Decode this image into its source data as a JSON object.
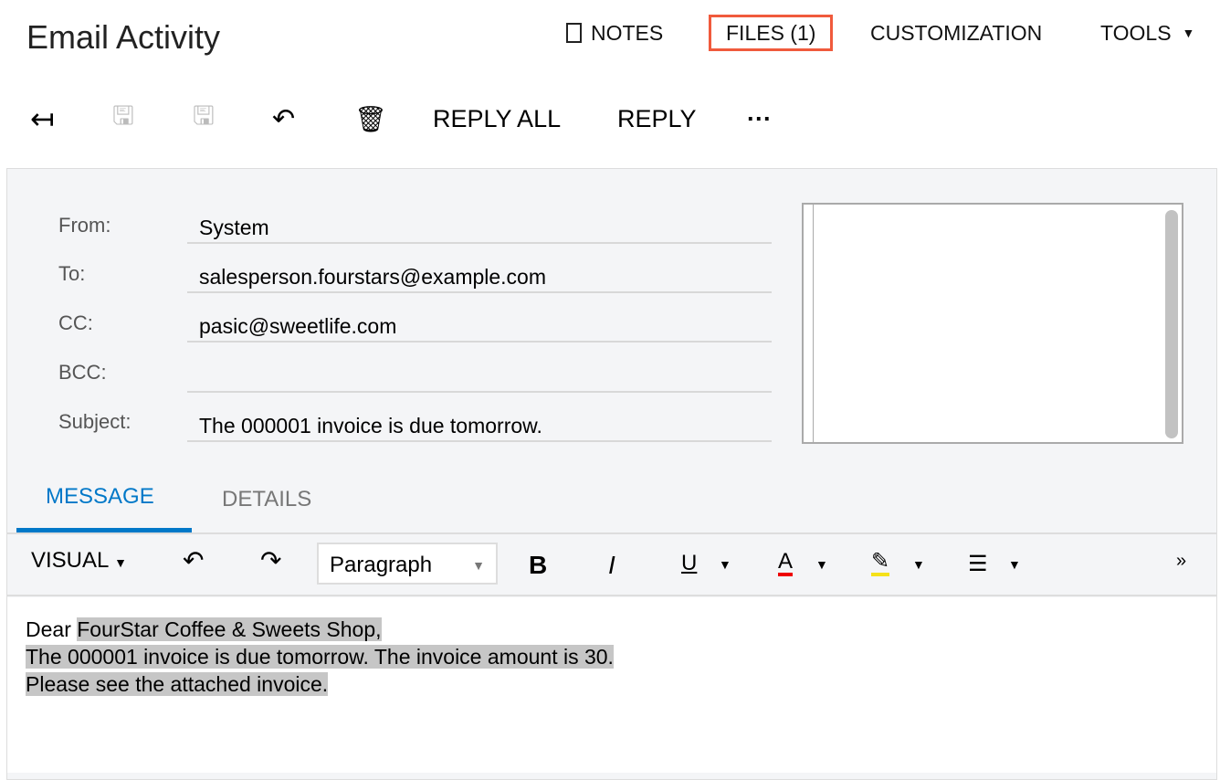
{
  "header": {
    "title": "Email Activity",
    "notes": "NOTES",
    "files": "FILES (1)",
    "customization": "CUSTOMIZATION",
    "tools": "TOOLS"
  },
  "toolbar": {
    "reply_all": "REPLY ALL",
    "reply": "REPLY",
    "more": "···"
  },
  "form": {
    "from_label": "From:",
    "from": "System",
    "to_label": "To:",
    "to": "salesperson.fourstars@example.com",
    "cc_label": "CC:",
    "cc": "pasic@sweetlife.com",
    "bcc_label": "BCC:",
    "bcc": "",
    "subject_label": "Subject:",
    "subject": "The 000001 invoice is due tomorrow."
  },
  "tabs": {
    "message": "MESSAGE",
    "details": "DETAILS"
  },
  "editor": {
    "mode": "VISUAL",
    "format": "Paragraph",
    "bold": "B",
    "italic": "I",
    "underline": "U",
    "color": "A",
    "lines": {
      "l1a": "Dear ",
      "l1b": "FourStar Coffee & Sweets Shop,",
      "l2": "The 000001 invoice is due tomorrow. The invoice amount is 30.",
      "l3": "Please see the attached invoice."
    }
  },
  "colors": {
    "accent": "#0078c8",
    "files_border": "#f05a3c"
  }
}
